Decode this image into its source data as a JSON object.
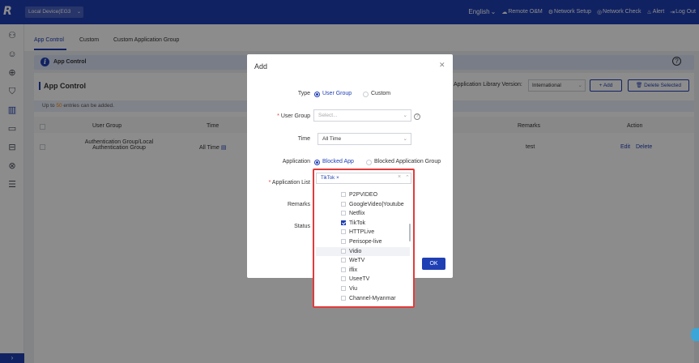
{
  "topbar": {
    "logo": "R",
    "device": "Local Device(EG3",
    "language": "English",
    "nav": [
      {
        "icon": "cloud-icon",
        "label": "Remote O&M"
      },
      {
        "icon": "network-icon",
        "label": "Network Setup"
      },
      {
        "icon": "check-icon",
        "label": "Network Check"
      },
      {
        "icon": "bell-icon",
        "label": "Alert"
      },
      {
        "icon": "logout-icon",
        "label": "Log Out"
      }
    ]
  },
  "tabs": [
    "App Control",
    "Custom",
    "Custom Application Group"
  ],
  "section": {
    "label": "App Control"
  },
  "page": {
    "title": "App Control",
    "library_label": "Application Library Version:",
    "library_value": "International",
    "add": "+ Add",
    "delete_selected": "Delete Selected",
    "notice_pre": "Up to",
    "notice_num": "50",
    "notice_post": "entries can be added."
  },
  "table": {
    "headers": [
      "User Group",
      "Time",
      "Remarks",
      "Action"
    ],
    "row": {
      "user_group_1": "Authentication Group/Local",
      "user_group_2": "Authentication Group",
      "time": "All Time",
      "remarks": "test",
      "edit": "Edit",
      "delete": "Delete"
    }
  },
  "modal": {
    "title": "Add",
    "type_label": "Type",
    "type_options": [
      "User Group",
      "Custom"
    ],
    "user_group_label": "User Group",
    "user_group_placeholder": "Select...",
    "time_label": "Time",
    "time_value": "All Time",
    "application_label": "Application",
    "application_options": [
      "Blocked App",
      "Blocked Application Group"
    ],
    "app_list_label": "Application List",
    "remarks_label": "Remarks",
    "status_label": "Status",
    "ok": "OK",
    "selected_tag": "TikTok",
    "options": [
      {
        "label": "P2PVIDEO",
        "checked": false
      },
      {
        "label": "GoogleVideo|Youtube",
        "checked": false
      },
      {
        "label": "Netflix",
        "checked": false
      },
      {
        "label": "TikTok",
        "checked": true
      },
      {
        "label": "HTTPLive",
        "checked": false
      },
      {
        "label": "Perisope-live",
        "checked": false
      },
      {
        "label": "Vidio",
        "checked": false
      },
      {
        "label": "WeTV",
        "checked": false
      },
      {
        "label": "iflix",
        "checked": false
      },
      {
        "label": "UseeTV",
        "checked": false
      },
      {
        "label": "Viu",
        "checked": false
      },
      {
        "label": "Channel-Myanmar",
        "checked": false
      }
    ]
  },
  "colors": {
    "brand": "#1f3fb4",
    "highlight": "#e23b3b"
  }
}
